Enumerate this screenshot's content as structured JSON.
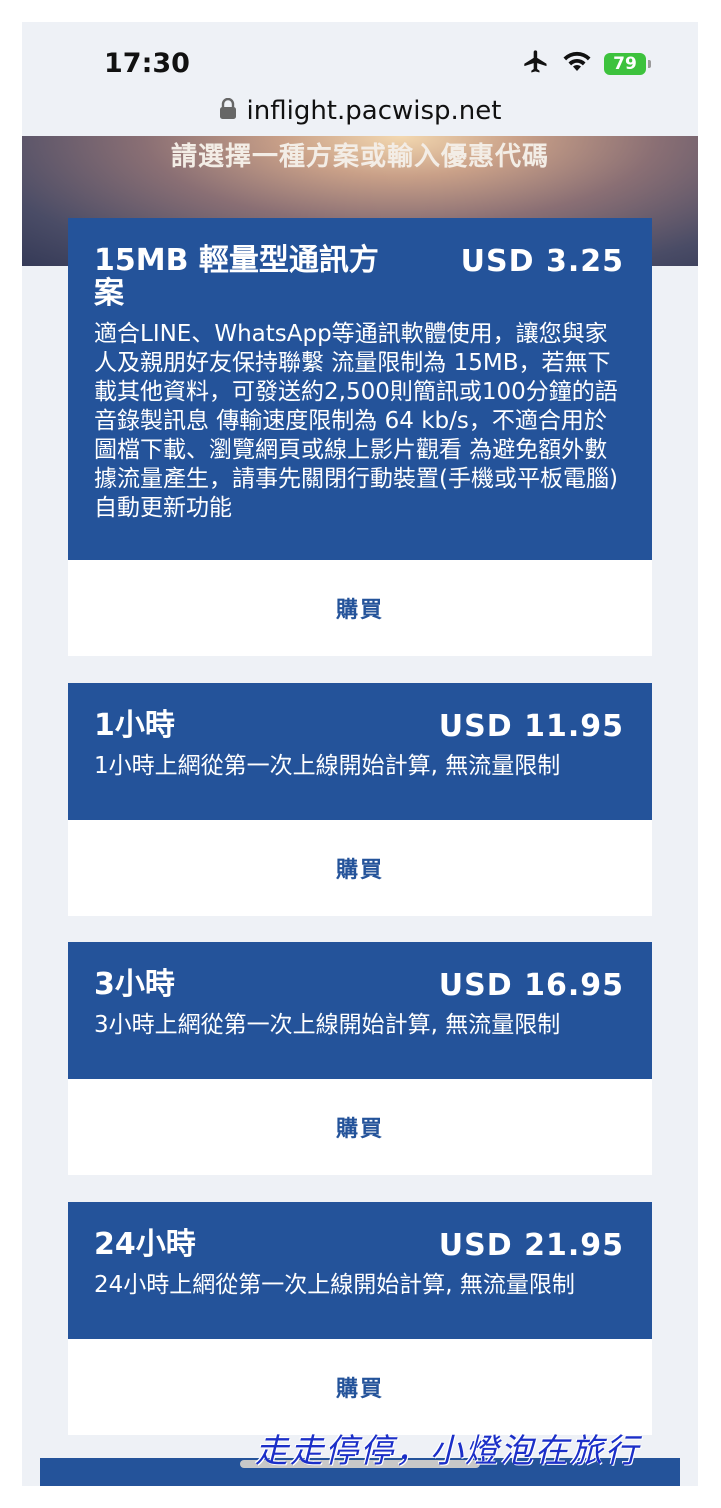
{
  "status_bar": {
    "time": "17:30",
    "battery": "79",
    "icons": [
      "airplane-icon",
      "wifi-icon",
      "battery-icon"
    ]
  },
  "browser": {
    "url": "inflight.pacwisp.net"
  },
  "header": {
    "title": "請選擇一種方案或輸入優惠代碼"
  },
  "plans": [
    {
      "title": "15MB 輕量型通訊方案",
      "price": "USD 3.25",
      "description": "適合LINE、WhatsApp等通訊軟體使用，讓您與家人及親朋好友保持聯繫 流量限制為 15MB，若無下載其他資料，可發送約2,500則簡訊或100分鐘的語音錄製訊息 傳輸速度限制為 64 kb/s，不適合用於圖檔下載、瀏覽網頁或線上影片觀看 為避免額外數據流量產生，請事先關閉行動裝置(手機或平板電腦)自動更新功能",
      "buy_label": "購買"
    },
    {
      "title": "1小時",
      "price": "USD 11.95",
      "description": "1小時上網從第一次上線開始計算, 無流量限制",
      "buy_label": "購買"
    },
    {
      "title": "3小時",
      "price": "USD 16.95",
      "description": "3小時上網從第一次上線開始計算, 無流量限制",
      "buy_label": "購買"
    },
    {
      "title": "24小時",
      "price": "USD 21.95",
      "description": "24小時上網從第一次上線開始計算, 無流量限制",
      "buy_label": "購買"
    }
  ],
  "watermark": "走走停停，小燈泡在旅行",
  "colors": {
    "card_blue": "#24539a",
    "background": "#eef1f6",
    "battery_green": "#3dc23d"
  }
}
